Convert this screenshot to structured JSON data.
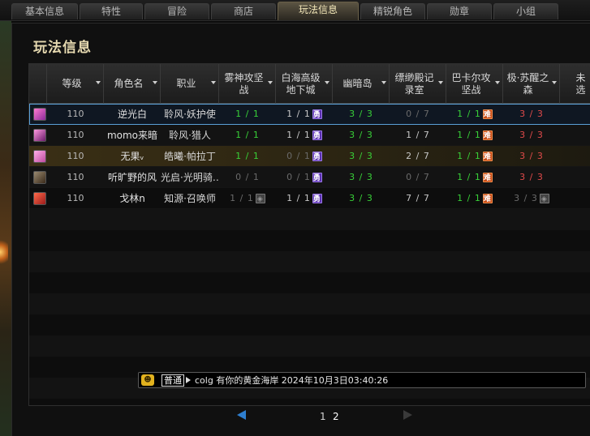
{
  "tabs": [
    "基本信息",
    "特性",
    "冒险",
    "商店",
    "玩法信息",
    "精锐角色",
    "勋章",
    "小组"
  ],
  "active_tab": 4,
  "panel_title": "玩法信息",
  "columns": [
    "等级",
    "角色名",
    "职业",
    "雾神攻坚\n战",
    "白海高级\n地下城",
    "幽暗岛",
    "缥缈殿记\n录室",
    "巴卡尔攻\n坚战",
    "极·苏醒之\n森",
    "未选"
  ],
  "rows": [
    {
      "level": "110",
      "name": "逆光白",
      "job": "聆风·妖护使",
      "c1": "1 / 1",
      "c2": "1 / 1",
      "c3": "3 / 3",
      "c4": "0 / 7",
      "c5": "1 / 1",
      "c6": "3 / 3",
      "c7": "–"
    },
    {
      "level": "110",
      "name": "momo来暗",
      "job": "聆风·猎人",
      "c1": "1 / 1",
      "c2": "1 / 1",
      "c3": "3 / 3",
      "c4": "1 / 7",
      "c5": "1 / 1",
      "c6": "3 / 3",
      "c7": "–"
    },
    {
      "level": "110",
      "name": "无果ᵥ",
      "job": "皓曦·帕拉丁",
      "c1": "1 / 1",
      "c2": "0 / 1",
      "c3": "3 / 3",
      "c4": "2 / 7",
      "c5": "1 / 1",
      "c6": "3 / 3",
      "c7": "–"
    },
    {
      "level": "110",
      "name": "听旷野的风",
      "job": "光启·光明骑…",
      "c1": "0 / 1",
      "c2": "0 / 1",
      "c3": "3 / 3",
      "c4": "0 / 7",
      "c5": "1 / 1",
      "c6": "3 / 3",
      "c7": "–"
    },
    {
      "level": "110",
      "name": "戈林n",
      "job": "知源·召唤师",
      "c1": "1 / 1",
      "c2": "1 / 1",
      "c3": "3 / 3",
      "c4": "7 / 7",
      "c5": "1 / 1",
      "c6": "3 / 3",
      "c7": "–"
    }
  ],
  "badges": {
    "hero": "勇",
    "hard": "难"
  },
  "chat": {
    "channel": "普通",
    "message": "colg 有你的黄金海岸 2024年10月3日03:40:26"
  },
  "pager": {
    "pages": [
      "1",
      "2"
    ],
    "current": "2"
  },
  "colors": {
    "accent_blue": "#2e7fd0",
    "green": "#38d038",
    "red": "#e04a4a",
    "gold_title": "#e6d9b0"
  }
}
